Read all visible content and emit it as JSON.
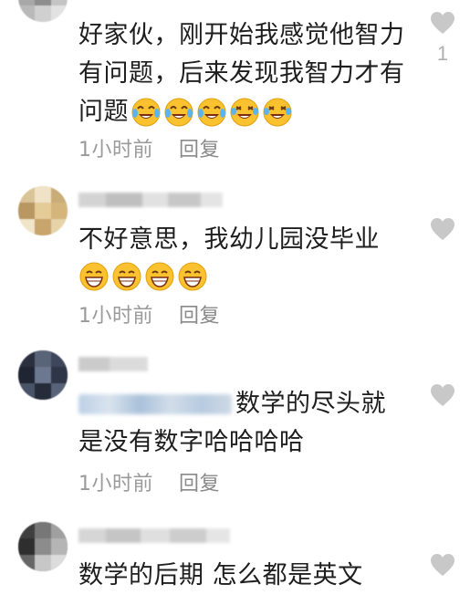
{
  "colors": {
    "meta_text": "#9a9a9a",
    "like_icon": "#c8c8c8",
    "body_text": "#1e1e1e"
  },
  "comments": [
    {
      "text_lines": [
        "好家伙，刚开始我感觉他智力",
        "有问题，后来发现我智力才有",
        "问题"
      ],
      "emojis": [
        "laugh-cry-icon",
        "laugh-cry-icon",
        "laugh-cry-icon",
        "laugh-cry-icon",
        "laugh-cry-icon"
      ],
      "time": "1小时前",
      "reply": "回复",
      "likes": "1"
    },
    {
      "text_lines": [
        "不好意思，我幼儿园没毕业"
      ],
      "emojis": [
        "grin-icon",
        "grin-icon",
        "grin-icon",
        "grin-icon"
      ],
      "time": "1小时前",
      "reply": "回复",
      "likes": ""
    },
    {
      "text_lines": [
        "数学的尽头就",
        "是没有数字哈哈哈哈"
      ],
      "emojis": [],
      "time": "1小时前",
      "reply": "回复",
      "likes": ""
    },
    {
      "text_lines": [
        "数学的后期 怎么都是英文"
      ],
      "emojis": [],
      "time": "",
      "reply": "",
      "likes": ""
    }
  ]
}
